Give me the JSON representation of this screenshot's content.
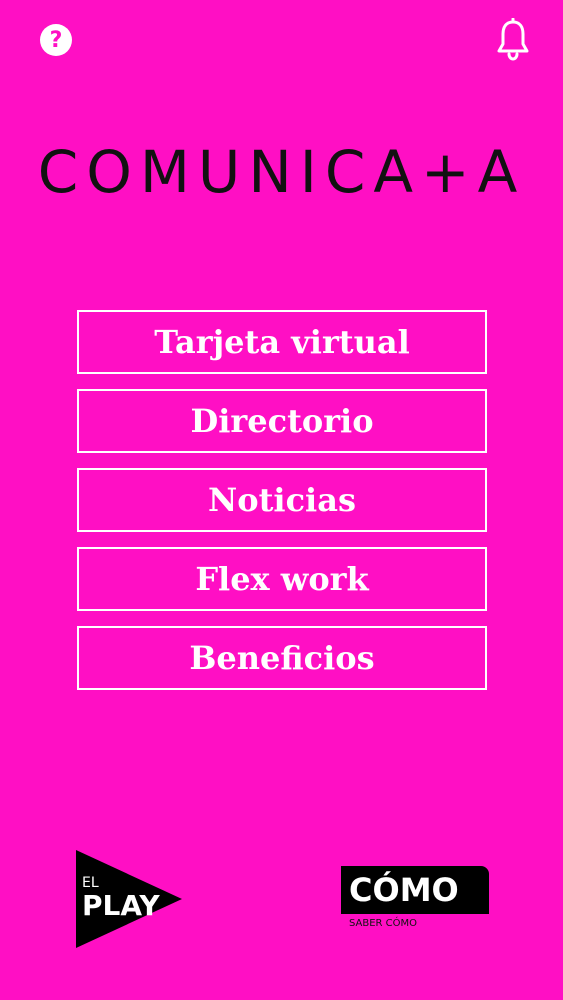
{
  "app": {
    "title": "COMUNICA+A"
  },
  "header": {
    "help_icon": "help-circle-icon",
    "notification_icon": "bell-icon"
  },
  "menu": {
    "items": [
      {
        "label": "Tarjeta virtual"
      },
      {
        "label": "Directorio"
      },
      {
        "label": "Noticias"
      },
      {
        "label": "Flex work"
      },
      {
        "label": "Beneficios"
      }
    ]
  },
  "footer": {
    "left_logo": {
      "small_text": "EL",
      "big_text": "PLAY"
    },
    "right_logo": {
      "big_text": "CÓMO",
      "small_text": "SABER CÓMO"
    }
  },
  "colors": {
    "background": "#FF0FC4",
    "text_dark": "#111111",
    "menu_text": "#FFFFFF",
    "logo_black": "#000000"
  }
}
